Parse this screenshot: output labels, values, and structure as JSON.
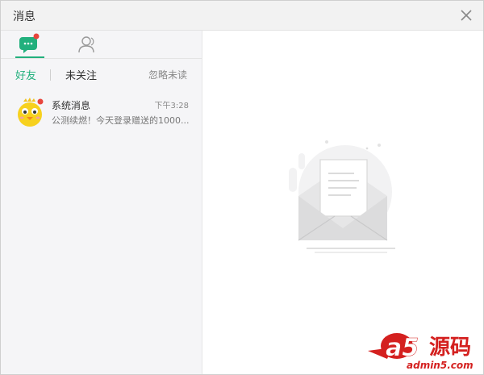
{
  "window": {
    "title": "消息"
  },
  "tabs": [
    {
      "name": "messages",
      "icon": "chat-bubble-icon",
      "active": true,
      "has_badge": true
    },
    {
      "name": "contacts",
      "icon": "contacts-icon",
      "active": false
    }
  ],
  "subtabs": {
    "friends": "好友",
    "unfollowed": "未关注",
    "ignore_unread": "忽略未读"
  },
  "messages": [
    {
      "name": "系统消息",
      "time": "下午3:28",
      "preview": "公测续燃！今天登录赠送的1000...",
      "avatar": "chick-avatar-icon",
      "unread": true
    }
  ],
  "watermark": {
    "brand": "a5",
    "cn": "源码",
    "domain": "admin5.com"
  },
  "colors": {
    "accent": "#22b07d",
    "badge": "#e8453c",
    "watermark_red": "#d4201f"
  }
}
